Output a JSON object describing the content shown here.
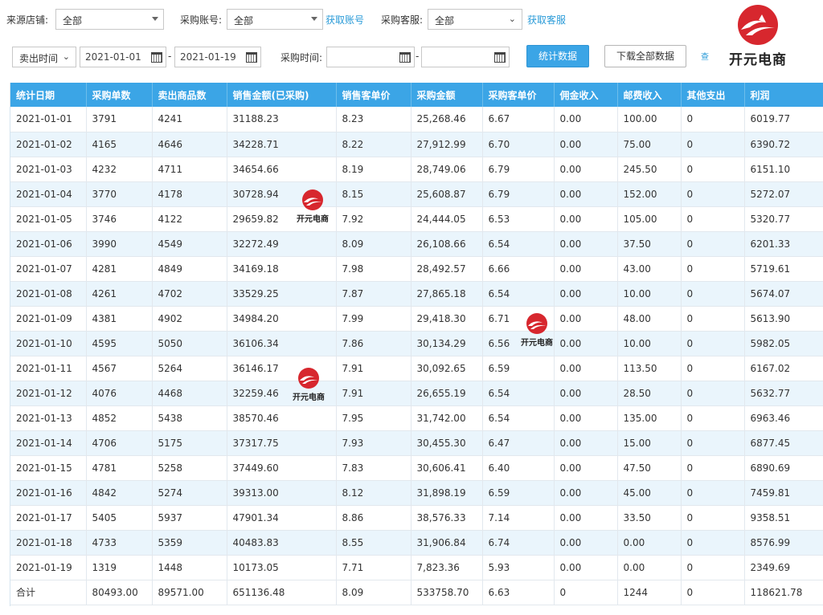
{
  "filters": {
    "source_store_label": "来源店铺:",
    "source_store_value": "全部",
    "purchase_account_label": "采购账号:",
    "purchase_account_value": "全部",
    "get_account_link": "获取账号",
    "purchase_cs_label": "采购客服:",
    "purchase_cs_value": "全部",
    "get_cs_link": "获取客服",
    "time_type_value": "卖出时间",
    "sold_date_start": "2021-01-01",
    "sold_date_end": "2021-01-19",
    "range_separator": "-",
    "purchase_time_label": "采购时间:",
    "purchase_date_start": "",
    "purchase_date_end": "",
    "stat_button": "统计数据",
    "download_button": "下载全部数据",
    "trailing_glyph": "查"
  },
  "logo": {
    "text": "开元电商",
    "brand_color": "#d7272e"
  },
  "table": {
    "headers": [
      "统计日期",
      "采购单数",
      "卖出商品数",
      "销售金额(已采购)",
      "销售客单价",
      "采购金额",
      "采购客单价",
      "佣金收入",
      "邮费收入",
      "其他支出",
      "利润"
    ],
    "rows": [
      [
        "2021-01-01",
        "3791",
        "4241",
        "31188.23",
        "8.23",
        "25,268.46",
        "6.67",
        "0.00",
        "100.00",
        "0",
        "6019.77"
      ],
      [
        "2021-01-02",
        "4165",
        "4646",
        "34228.71",
        "8.22",
        "27,912.99",
        "6.70",
        "0.00",
        "75.00",
        "0",
        "6390.72"
      ],
      [
        "2021-01-03",
        "4232",
        "4711",
        "34654.66",
        "8.19",
        "28,749.06",
        "6.79",
        "0.00",
        "245.50",
        "0",
        "6151.10"
      ],
      [
        "2021-01-04",
        "3770",
        "4178",
        "30728.94",
        "8.15",
        "25,608.87",
        "6.79",
        "0.00",
        "152.00",
        "0",
        "5272.07"
      ],
      [
        "2021-01-05",
        "3746",
        "4122",
        "29659.82",
        "7.92",
        "24,444.05",
        "6.53",
        "0.00",
        "105.00",
        "0",
        "5320.77"
      ],
      [
        "2021-01-06",
        "3990",
        "4549",
        "32272.49",
        "8.09",
        "26,108.66",
        "6.54",
        "0.00",
        "37.50",
        "0",
        "6201.33"
      ],
      [
        "2021-01-07",
        "4281",
        "4849",
        "34169.18",
        "7.98",
        "28,492.57",
        "6.66",
        "0.00",
        "43.00",
        "0",
        "5719.61"
      ],
      [
        "2021-01-08",
        "4261",
        "4702",
        "33529.25",
        "7.87",
        "27,865.18",
        "6.54",
        "0.00",
        "10.00",
        "0",
        "5674.07"
      ],
      [
        "2021-01-09",
        "4381",
        "4902",
        "34984.20",
        "7.99",
        "29,418.30",
        "6.71",
        "0.00",
        "48.00",
        "0",
        "5613.90"
      ],
      [
        "2021-01-10",
        "4595",
        "5050",
        "36106.34",
        "7.86",
        "30,134.29",
        "6.56",
        "0.00",
        "10.00",
        "0",
        "5982.05"
      ],
      [
        "2021-01-11",
        "4567",
        "5264",
        "36146.17",
        "7.91",
        "30,092.65",
        "6.59",
        "0.00",
        "113.50",
        "0",
        "6167.02"
      ],
      [
        "2021-01-12",
        "4076",
        "4468",
        "32259.46",
        "7.91",
        "26,655.19",
        "6.54",
        "0.00",
        "28.50",
        "0",
        "5632.77"
      ],
      [
        "2021-01-13",
        "4852",
        "5438",
        "38570.46",
        "7.95",
        "31,742.00",
        "6.54",
        "0.00",
        "135.00",
        "0",
        "6963.46"
      ],
      [
        "2021-01-14",
        "4706",
        "5175",
        "37317.75",
        "7.93",
        "30,455.30",
        "6.47",
        "0.00",
        "15.00",
        "0",
        "6877.45"
      ],
      [
        "2021-01-15",
        "4781",
        "5258",
        "37449.60",
        "7.83",
        "30,606.41",
        "6.40",
        "0.00",
        "47.50",
        "0",
        "6890.69"
      ],
      [
        "2021-01-16",
        "4842",
        "5274",
        "39313.00",
        "8.12",
        "31,898.19",
        "6.59",
        "0.00",
        "45.00",
        "0",
        "7459.81"
      ],
      [
        "2021-01-17",
        "5405",
        "5937",
        "47901.34",
        "8.86",
        "38,576.33",
        "7.14",
        "0.00",
        "33.50",
        "0",
        "9358.51"
      ],
      [
        "2021-01-18",
        "4733",
        "5359",
        "40483.83",
        "8.55",
        "31,906.84",
        "6.74",
        "0.00",
        "0.00",
        "0",
        "8576.99"
      ],
      [
        "2021-01-19",
        "1319",
        "1448",
        "10173.05",
        "7.71",
        "7,823.36",
        "5.93",
        "0.00",
        "0.00",
        "0",
        "2349.69"
      ]
    ],
    "total_row": [
      "合计",
      "80493.00",
      "89571.00",
      "651136.48",
      "8.09",
      "533758.70",
      "6.63",
      "0",
      "1244",
      "0",
      "118621.78"
    ]
  },
  "watermarks": [
    {
      "text": "开元电商"
    },
    {
      "text": "开元电商"
    },
    {
      "text": "开元电商"
    }
  ]
}
